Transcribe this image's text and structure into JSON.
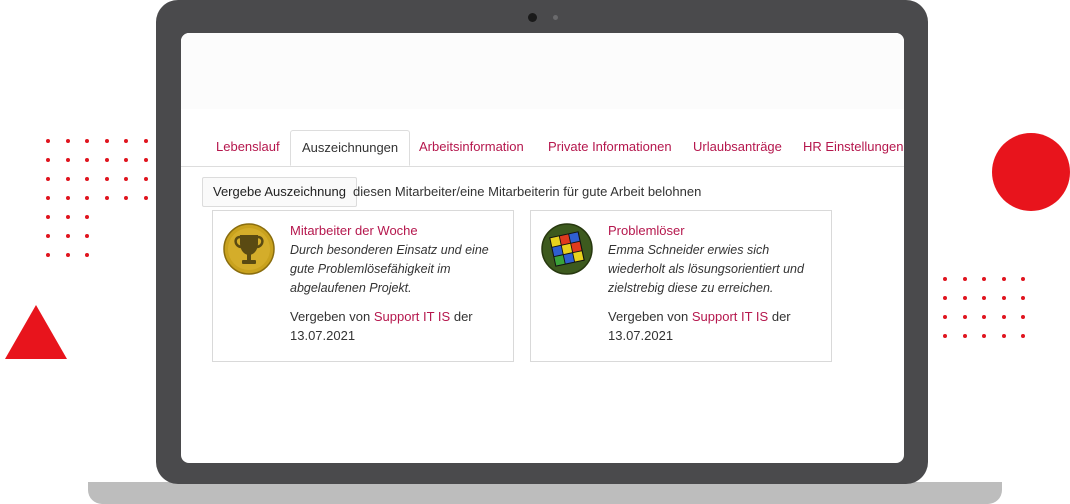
{
  "tabs": [
    {
      "label": "Lebenslauf",
      "active": false
    },
    {
      "label": "Auszeichnungen",
      "active": true
    },
    {
      "label": "Arbeitsinformation",
      "active": false
    },
    {
      "label": "Private Informationen",
      "active": false
    },
    {
      "label": "Urlaubsanträge",
      "active": false
    },
    {
      "label": "HR Einstellungen",
      "active": false
    }
  ],
  "award_bar": {
    "button_label": "Vergebe Auszeichnung",
    "hint": "diesen Mitarbeiter/eine Mitarbeiterin für gute Arbeit belohnen"
  },
  "cards": [
    {
      "icon": "trophy-icon",
      "title": "Mitarbeiter der Woche",
      "description": "Durch besonderen Einsatz und eine gute Problemlösefähigkeit im abgelaufenen Projekt.",
      "footer_prefix": "Vergeben von",
      "awarded_by": "Support IT IS",
      "footer_mid": "der",
      "date": "13.07.2021"
    },
    {
      "icon": "rubiks-cube-icon",
      "title": "Problemlöser",
      "description": "Emma Schneider erwies sich wiederholt als lösungsorientiert und zielstrebig diese zu erreichen.",
      "footer_prefix": "Vergeben von",
      "awarded_by": "Support IT IS",
      "footer_mid": "der",
      "date": "13.07.2021"
    }
  ],
  "colors": {
    "accent": "#b5174d",
    "decoration_red": "#e8141c",
    "laptop_frame": "#4a4a4c",
    "laptop_base": "#bdbdbd"
  }
}
